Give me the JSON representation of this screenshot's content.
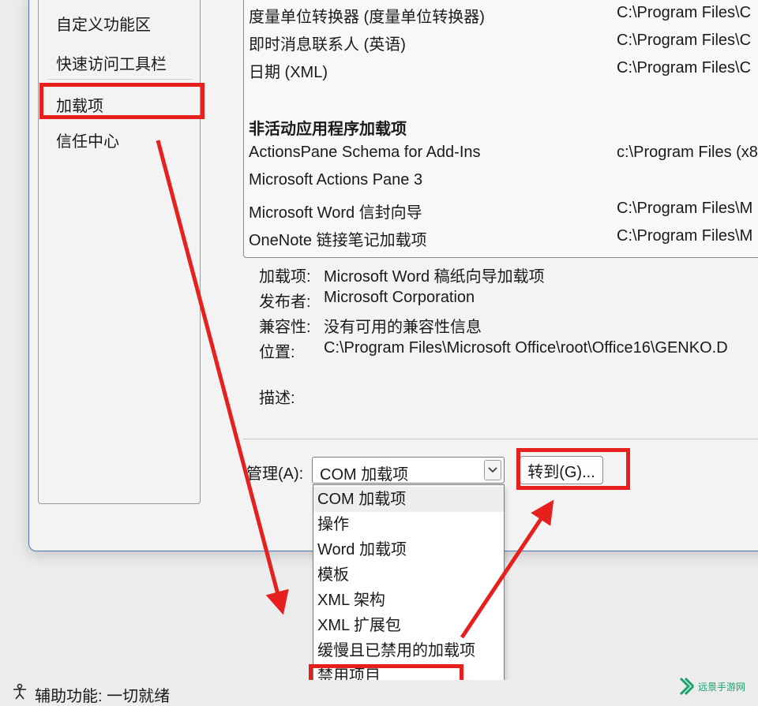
{
  "nav": {
    "items": [
      {
        "label": "自定义功能区"
      },
      {
        "label": "快速访问工具栏"
      },
      {
        "label": "加载项"
      },
      {
        "label": "信任中心"
      }
    ]
  },
  "addins": {
    "active_rows": [
      {
        "name": "度量单位转换器 (度量单位转换器)",
        "location": "C:\\Program Files\\C"
      },
      {
        "name": "即时消息联系人 (英语)",
        "location": "C:\\Program Files\\C"
      },
      {
        "name": "日期 (XML)",
        "location": "C:\\Program Files\\C"
      }
    ],
    "inactive_header": "非活动应用程序加载项",
    "inactive_rows": [
      {
        "name": "ActionsPane Schema for Add-Ins",
        "location": "c:\\Program Files (x8"
      },
      {
        "name": "Microsoft Actions Pane 3",
        "location": ""
      },
      {
        "name": "Microsoft Word 信封向导",
        "location": "C:\\Program Files\\M"
      },
      {
        "name": "OneNote 链接笔记加载项",
        "location": "C:\\Program Files\\M"
      }
    ]
  },
  "details": {
    "addin_label": "加载项:",
    "addin_value": "Microsoft Word 稿纸向导加载项",
    "publisher_label": "发布者:",
    "publisher_value": "Microsoft Corporation",
    "compat_label": "兼容性:",
    "compat_value": "没有可用的兼容性信息",
    "location_label": "位置:",
    "location_value": "C:\\Program Files\\Microsoft Office\\root\\Office16\\GENKO.D",
    "desc_label": "描述:"
  },
  "manage": {
    "label": "管理(A):",
    "selected": "COM 加载项",
    "go_button": "转到(G)...",
    "options": [
      "COM 加载项",
      "操作",
      "Word 加载项",
      "模板",
      "XML 架构",
      "XML 扩展包",
      "缓慢且已禁用的加载项",
      "禁用项目"
    ]
  },
  "status": {
    "text": "辅助功能: 一切就绪"
  },
  "watermark": {
    "text": "远景手游网"
  },
  "colors": {
    "highlight": "#e5201f",
    "dialog_border": "#4a76b8"
  }
}
